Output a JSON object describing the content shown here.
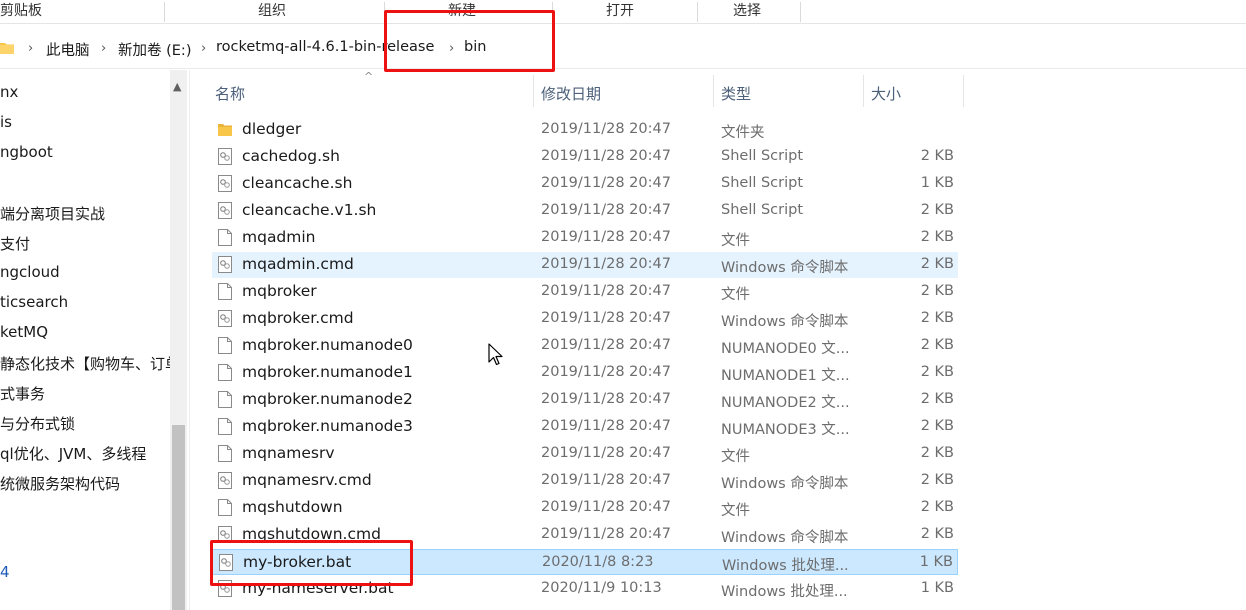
{
  "ribbon": {
    "clipboard": "剪贴板",
    "organize": "组织",
    "new": "新建",
    "open": "打开",
    "select": "选择"
  },
  "breadcrumb": {
    "this_pc": "此电脑",
    "drive": "新加卷 (E:)",
    "folder": "rocketmq-all-4.6.1-bin-release",
    "current": "bin"
  },
  "nav": {
    "items": [
      "nx",
      "is",
      "ngboot",
      "端分离项目实战",
      "支付",
      "ngcloud",
      "ticsearch",
      "ketMQ",
      "静态化技术【购物车、订单",
      "式事务",
      "与分布式锁",
      "ql优化、JVM、多线程",
      "统微服务架构代码",
      "4"
    ]
  },
  "columns": {
    "name": "名称",
    "modified": "修改日期",
    "type": "类型",
    "size": "大小"
  },
  "files": [
    {
      "name": "dledger",
      "date": "2019/11/28 20:47",
      "type": "文件夹",
      "size": "",
      "icon": "folder-icon"
    },
    {
      "name": "cachedog.sh",
      "date": "2019/11/28 20:47",
      "type": "Shell Script",
      "size": "2 KB",
      "icon": "script-file-icon"
    },
    {
      "name": "cleancache.sh",
      "date": "2019/11/28 20:47",
      "type": "Shell Script",
      "size": "1 KB",
      "icon": "script-file-icon"
    },
    {
      "name": "cleancache.v1.sh",
      "date": "2019/11/28 20:47",
      "type": "Shell Script",
      "size": "2 KB",
      "icon": "script-file-icon"
    },
    {
      "name": "mqadmin",
      "date": "2019/11/28 20:47",
      "type": "文件",
      "size": "2 KB",
      "icon": "file-icon"
    },
    {
      "name": "mqadmin.cmd",
      "date": "2019/11/28 20:47",
      "type": "Windows 命令脚本",
      "size": "2 KB",
      "icon": "script-file-icon"
    },
    {
      "name": "mqbroker",
      "date": "2019/11/28 20:47",
      "type": "文件",
      "size": "2 KB",
      "icon": "file-icon"
    },
    {
      "name": "mqbroker.cmd",
      "date": "2019/11/28 20:47",
      "type": "Windows 命令脚本",
      "size": "2 KB",
      "icon": "script-file-icon"
    },
    {
      "name": "mqbroker.numanode0",
      "date": "2019/11/28 20:47",
      "type": "NUMANODE0 文...",
      "size": "2 KB",
      "icon": "file-icon"
    },
    {
      "name": "mqbroker.numanode1",
      "date": "2019/11/28 20:47",
      "type": "NUMANODE1 文...",
      "size": "2 KB",
      "icon": "file-icon"
    },
    {
      "name": "mqbroker.numanode2",
      "date": "2019/11/28 20:47",
      "type": "NUMANODE2 文...",
      "size": "2 KB",
      "icon": "file-icon"
    },
    {
      "name": "mqbroker.numanode3",
      "date": "2019/11/28 20:47",
      "type": "NUMANODE3 文...",
      "size": "2 KB",
      "icon": "file-icon"
    },
    {
      "name": "mqnamesrv",
      "date": "2019/11/28 20:47",
      "type": "文件",
      "size": "2 KB",
      "icon": "file-icon"
    },
    {
      "name": "mqnamesrv.cmd",
      "date": "2019/11/28 20:47",
      "type": "Windows 命令脚本",
      "size": "2 KB",
      "icon": "script-file-icon"
    },
    {
      "name": "mqshutdown",
      "date": "2019/11/28 20:47",
      "type": "文件",
      "size": "2 KB",
      "icon": "file-icon"
    },
    {
      "name": "mqshutdown.cmd",
      "date": "2019/11/28 20:47",
      "type": "Windows 命令脚本",
      "size": "2 KB",
      "icon": "script-file-icon"
    },
    {
      "name": "my-broker.bat",
      "date": "2020/11/8 8:23",
      "type": "Windows 批处理...",
      "size": "1 KB",
      "icon": "script-file-icon"
    },
    {
      "name": "my-nameserver.bat",
      "date": "2020/11/9 10:13",
      "type": "Windows 批处理...",
      "size": "1 KB",
      "icon": "script-file-icon"
    }
  ],
  "hovered_file": "mqadmin.cmd",
  "selected_file": "my-broker.bat",
  "colors": {
    "highlight_box": "#ee1111",
    "selection": "#cce8ff",
    "hover": "#e5f3ff",
    "folder": "#f8c648"
  }
}
